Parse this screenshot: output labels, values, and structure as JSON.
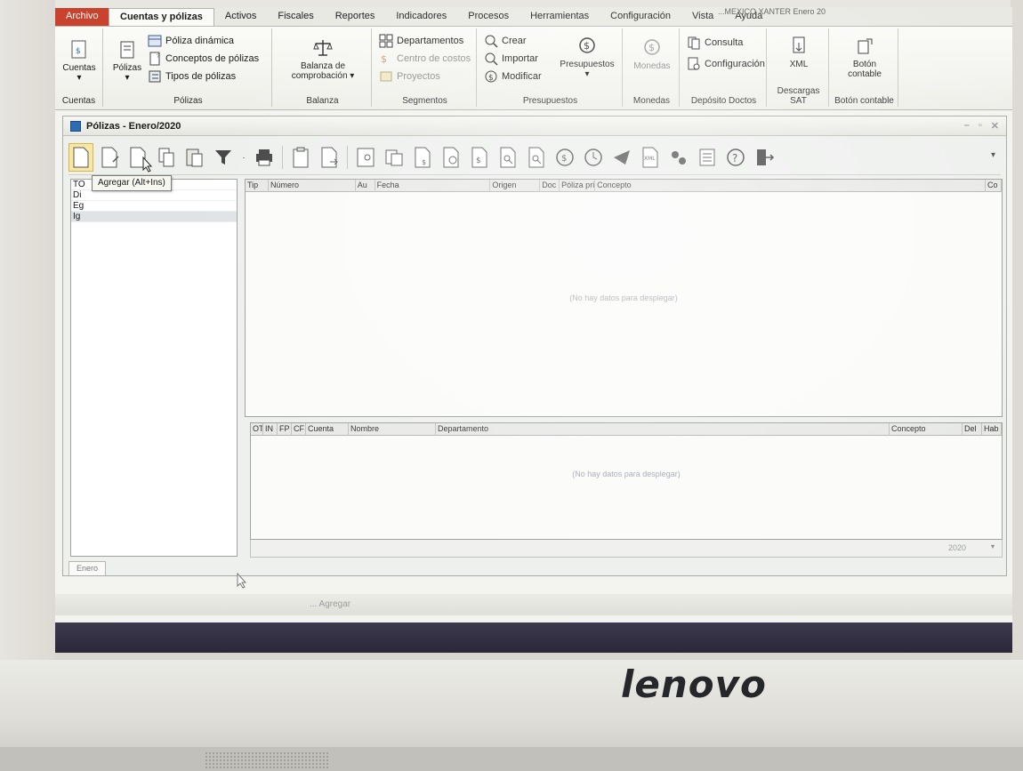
{
  "menu": {
    "file": "Archivo",
    "items": [
      "Cuentas y pólizas",
      "Activos",
      "Fiscales",
      "Reportes",
      "Indicadores",
      "Procesos",
      "Herramientas",
      "Configuración",
      "Vista",
      "Ayuda"
    ],
    "active_index": 0,
    "title_fragment": "...MEXICO XANTER Enero 20"
  },
  "ribbon": {
    "cuentas": {
      "button": "Cuentas",
      "group": "Cuentas"
    },
    "polizas": {
      "button": "Pólizas",
      "poliza_dinamica": "Póliza dinámica",
      "conceptos": "Conceptos de pólizas",
      "tipos": "Tipos de pólizas",
      "group": "Pólizas"
    },
    "balanza": {
      "button": "Balanza de comprobación ▾",
      "group": "Balanza"
    },
    "segmentos": {
      "departamentos": "Departamentos",
      "centro_costos": "Centro de costos",
      "proyectos": "Proyectos",
      "group": "Segmentos"
    },
    "presupuestos": {
      "crear": "Crear",
      "importar": "Importar",
      "modificar": "Modificar",
      "button": "Presupuestos",
      "group": "Presupuestos"
    },
    "monedas": {
      "button": "Monedas",
      "group": "Monedas"
    },
    "deposito": {
      "consulta": "Consulta",
      "configuracion": "Configuración",
      "group": "Depósito Doctos"
    },
    "descargas": {
      "button": "XML",
      "group": "Descargas SAT"
    },
    "boton_contable": {
      "button": "Botón contable",
      "group": "Botón contable"
    }
  },
  "window": {
    "title": "Pólizas - Enero/2020",
    "controls": [
      "–",
      "▫",
      "✕"
    ]
  },
  "tooltip": "Agregar (Alt+Ins)",
  "type_list": [
    "TO",
    "Di",
    "Eg",
    "Ig"
  ],
  "type_list_selected": 3,
  "grid_top": {
    "columns": [
      {
        "label": "Tip",
        "w": 26
      },
      {
        "label": "Número",
        "w": 98
      },
      {
        "label": "Au",
        "w": 22
      },
      {
        "label": "Fecha",
        "w": 130
      },
      {
        "label": "Origen",
        "w": 56
      },
      {
        "label": "Doc",
        "w": 22
      },
      {
        "label": "Póliza pri",
        "w": 40
      },
      {
        "label": "Concepto",
        "w": 440
      },
      {
        "label": "Co",
        "w": 18
      }
    ],
    "empty": "(No hay datos para desplegar)"
  },
  "grid_bottom": {
    "columns": [
      {
        "label": "OT",
        "w": 14
      },
      {
        "label": "IN",
        "w": 16
      },
      {
        "label": "FP",
        "w": 16
      },
      {
        "label": "CF",
        "w": 16
      },
      {
        "label": "Cuenta",
        "w": 48
      },
      {
        "label": "Nombre",
        "w": 98
      },
      {
        "label": "Departamento",
        "w": 510
      },
      {
        "label": "Concepto",
        "w": 82
      },
      {
        "label": "Del",
        "w": 22
      },
      {
        "label": "Hab",
        "w": 22
      }
    ],
    "empty": "(No hay datos para desplegar)"
  },
  "footer": {
    "year": "2020",
    "dropdown": "▾"
  },
  "status": {
    "month": "Enero"
  },
  "taskbar_ghost": "... Agregar",
  "brand": "lenovo",
  "colors": {
    "file_tab": "#c9422e",
    "selected_tool": "#f8e8a4",
    "icon_blue": "#2e6bb5"
  }
}
